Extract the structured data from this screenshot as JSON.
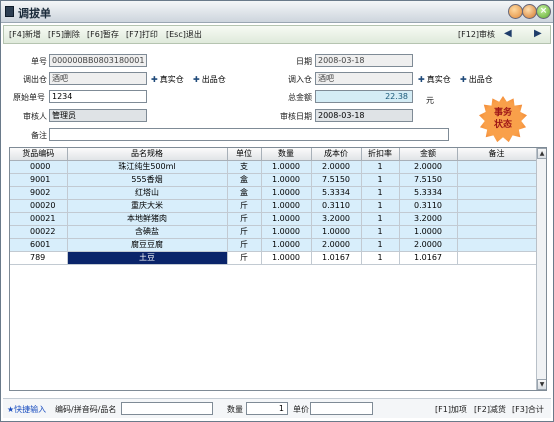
{
  "window": {
    "title": "调拔单"
  },
  "toolbar": {
    "new": "[F4]新增",
    "delete": "[F5]删除",
    "hold": "[F6]暂存",
    "print": "[F7]打印",
    "exit": "[Esc]退出",
    "audit": "[F12]审核"
  },
  "form": {
    "doc_no_label": "单号",
    "doc_no": "000000BB0803180001",
    "date_label": "日期",
    "date": "2008-03-18",
    "out_wh_label": "调出仓",
    "out_wh": "酒吧",
    "in_wh_label": "调入仓",
    "in_wh": "酒吧",
    "real_wh": "真实仓",
    "out_goods_wh": "出品仓",
    "orig_no_label": "原始单号",
    "orig_no": "1234",
    "total_label": "总金额",
    "total": "22.38",
    "currency": "元",
    "auditor_label": "审核人",
    "auditor": "管理员",
    "audit_date_label": "审核日期",
    "audit_date": "2008-03-18",
    "remark_label": "备注",
    "remark": ""
  },
  "stamp": {
    "line1": "事务",
    "line2": "状态"
  },
  "table": {
    "headers": [
      "货品编码",
      "品名规格",
      "单位",
      "数量",
      "成本价",
      "折扣率",
      "金额",
      "备注"
    ],
    "rows": [
      [
        "0000",
        "珠江纯生500ml",
        "支",
        "1.0000",
        "2.0000",
        "1",
        "2.0000",
        ""
      ],
      [
        "9001",
        "555香烟",
        "盒",
        "1.0000",
        "7.5150",
        "1",
        "7.5150",
        ""
      ],
      [
        "9002",
        "红塔山",
        "盒",
        "1.0000",
        "5.3334",
        "1",
        "5.3334",
        ""
      ],
      [
        "00020",
        "重庆大米",
        "斤",
        "1.0000",
        "0.3110",
        "1",
        "0.3110",
        ""
      ],
      [
        "00021",
        "本地鲜猪肉",
        "斤",
        "1.0000",
        "3.2000",
        "1",
        "3.2000",
        ""
      ],
      [
        "00022",
        "含碘盐",
        "斤",
        "1.0000",
        "1.0000",
        "1",
        "1.0000",
        ""
      ],
      [
        "6001",
        "腐豆豆腐",
        "斤",
        "1.0000",
        "2.0000",
        "1",
        "2.0000",
        ""
      ],
      [
        "789",
        "土豆",
        "斤",
        "1.0000",
        "1.0167",
        "1",
        "1.0167",
        ""
      ]
    ]
  },
  "status": {
    "quick_input": "★快捷输入",
    "code_label": "编码/拼音码/品名",
    "qty_label": "数量",
    "qty": "1",
    "price_label": "单价",
    "add": "[F1]加项",
    "remove": "[F2]减货",
    "total": "[F3]合计"
  },
  "colors": {
    "row_bg": "#d8eefb",
    "selected_cell": "#0a246a",
    "toolbar_bg": "#e8f0e4"
  }
}
